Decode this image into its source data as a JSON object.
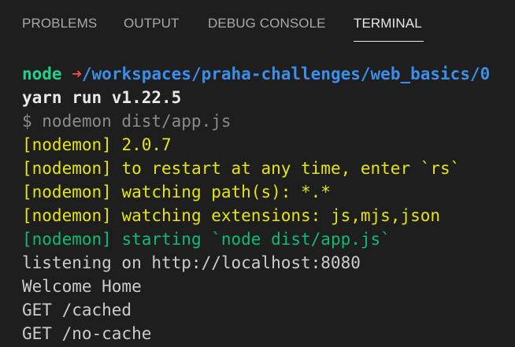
{
  "tabs": [
    {
      "label": "PROBLEMS"
    },
    {
      "label": "OUTPUT"
    },
    {
      "label": "DEBUG CONSOLE"
    },
    {
      "label": "TERMINAL"
    }
  ],
  "active_tab": "TERMINAL",
  "terminal": {
    "prompt": {
      "user": "node",
      "arrow": "➜",
      "path": "/workspaces/praha-challenges/web_basics/0"
    },
    "yarn_line": "yarn run v1.22.5",
    "command_line": "$ nodemon dist/app.js",
    "nodemon_lines": [
      {
        "tag": "[nodemon]",
        "text": " 2.0.7"
      },
      {
        "tag": "[nodemon]",
        "text": " to restart at any time, enter `rs`"
      },
      {
        "tag": "[nodemon]",
        "text": " watching path(s): *.*"
      },
      {
        "tag": "[nodemon]",
        "text": " watching extensions: js,mjs,json"
      }
    ],
    "starting_line": {
      "tag": "[nodemon]",
      "text": " starting `node dist/app.js`"
    },
    "output_lines": [
      "listening on http://localhost:8080",
      "Welcome Home",
      "GET /cached",
      "GET /no-cache"
    ]
  },
  "colors": {
    "background": "#1e1e1e",
    "prompt_green": "#23d18b",
    "arrow_red": "#f14c4c",
    "path_blue": "#3b8eea",
    "nodemon_yellow": "#e5e510",
    "nodemon_start_green": "#0dbc79"
  }
}
